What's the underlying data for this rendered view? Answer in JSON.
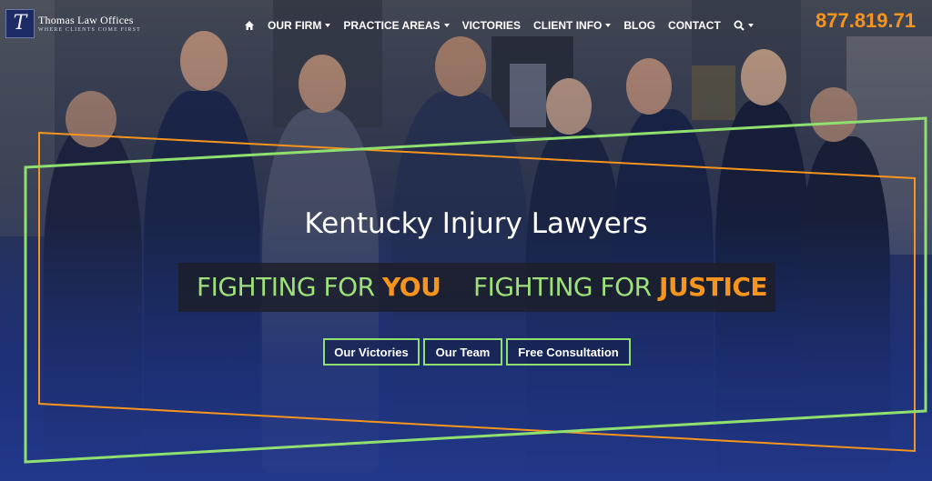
{
  "logo": {
    "name": "Thomas Law Offices",
    "tagline": "WHERE CLIENTS COME FIRST",
    "mark": "T"
  },
  "nav": {
    "items": [
      {
        "label": "OUR FIRM",
        "dropdown": true
      },
      {
        "label": "PRACTICE AREAS",
        "dropdown": true
      },
      {
        "label": "VICTORIES",
        "dropdown": false
      },
      {
        "label": "CLIENT INFO",
        "dropdown": true
      },
      {
        "label": "BLOG",
        "dropdown": false
      },
      {
        "label": "CONTACT",
        "dropdown": false
      }
    ],
    "home_icon": "home-icon",
    "search_icon": "search-icon"
  },
  "phone": "877.819.71",
  "hero": {
    "headline": "Kentucky Injury Lawyers",
    "tagline_left_prefix": "FIGHTING FOR ",
    "tagline_left_emphasis": "YOU",
    "tagline_right_prefix": "FIGHTING FOR ",
    "tagline_right_emphasis": "JUSTICE",
    "buttons": [
      "Our Victories",
      "Our Team",
      "Free Consultation"
    ]
  },
  "colors": {
    "accent_orange": "#f7941d",
    "accent_green": "#8fe06f",
    "navy": "#1e3476"
  }
}
